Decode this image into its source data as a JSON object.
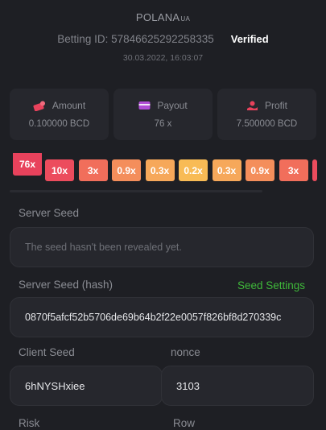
{
  "header": {
    "username": "POLANA",
    "country_suffix": "UA",
    "bet_id_label": "Betting ID: 5784662529225833",
    "bet_id_tail": "5",
    "verified_label": "Verified",
    "timestamp": "30.03.2022, 16:03:07"
  },
  "stats": [
    {
      "label": "Amount",
      "value": "0.100000 BCD",
      "icon": "amount-icon"
    },
    {
      "label": "Payout",
      "value": "76 x",
      "icon": "payout-icon"
    },
    {
      "label": "Profit",
      "value": "7.500000 BCD",
      "icon": "profit-icon"
    }
  ],
  "multipliers": {
    "active": "76x",
    "items": [
      "10x",
      "3x",
      "0.9x",
      "0.3x",
      "0.2x",
      "0.3x",
      "0.9x",
      "3x"
    ],
    "colors": [
      "#ec4c5d",
      "#f16e5b",
      "#f48e5b",
      "#f6a85a",
      "#f8bb55",
      "#f6a85a",
      "#f48e5b",
      "#f16e5b"
    ]
  },
  "server_seed": {
    "label": "Server Seed",
    "placeholder": "The seed hasn't been revealed yet."
  },
  "server_seed_hash": {
    "label": "Server Seed (hash)",
    "settings_link": "Seed Settings",
    "value": "0870f5afcf52b5706de69b64b2f22e0057f826bf8d270339c"
  },
  "client_seed": {
    "label": "Client Seed",
    "value": "6hNYSHxiee"
  },
  "nonce": {
    "label": "nonce",
    "value": "3103"
  },
  "risk": {
    "label": "Risk"
  },
  "row": {
    "label": "Row"
  },
  "colors": {
    "accent_green": "#3fb83a",
    "active_red": "#e8425c",
    "background": "#1e1f24",
    "card": "#26272d"
  }
}
